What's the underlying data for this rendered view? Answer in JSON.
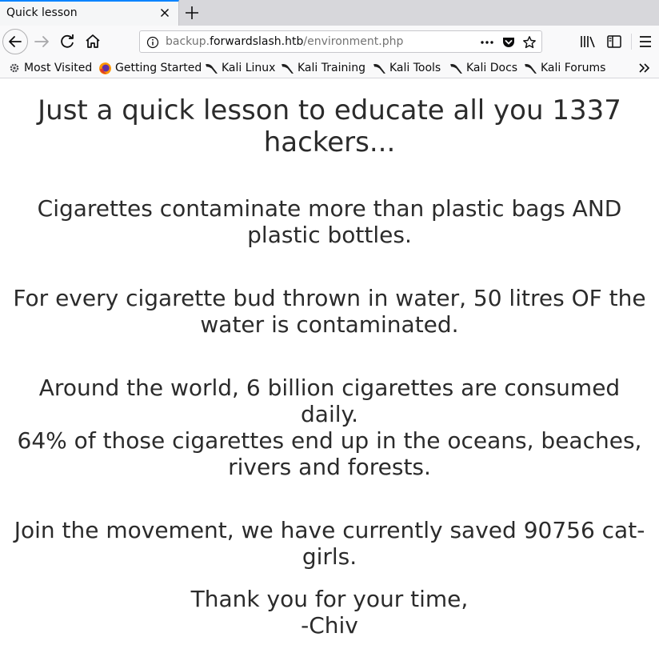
{
  "tab": {
    "title": "Quick lesson",
    "close_icon": "close-icon",
    "new_tab_icon": "plus-icon"
  },
  "nav": {
    "url_scheme_prefix": "backup.",
    "url_domain": "forwardslash.htb",
    "url_path": "/environment.php"
  },
  "bookmarks": [
    {
      "label": "Most Visited",
      "icon": "gear-icon"
    },
    {
      "label": "Getting Started",
      "icon": "firefox-icon"
    },
    {
      "label": "Kali Linux",
      "icon": "kali-dragon-icon"
    },
    {
      "label": "Kali Training",
      "icon": "kali-dragon-icon"
    },
    {
      "label": "Kali Tools",
      "icon": "kali-dragon-icon"
    },
    {
      "label": "Kali Docs",
      "icon": "kali-dragon-icon"
    },
    {
      "label": "Kali Forums",
      "icon": "kali-dragon-icon"
    }
  ],
  "content": {
    "headline": "Just a quick lesson to educate all you 1337 hackers...",
    "paragraph1": "Cigarettes contaminate more than plastic bags AND plastic bottles.",
    "paragraph2": "For every cigarette bud thrown in water, 50 litres OF the water is contaminated.",
    "paragraph3_line1": "Around the world, 6 billion cigarettes are consumed daily.",
    "paragraph3_line2": "64% of those cigarettes end up in the oceans, beaches, rivers and forests.",
    "paragraph4": "Join the movement, we have currently saved 90756 cat-girls.",
    "signoff_line1": "Thank you for your time,",
    "signoff_line2": "-Chiv"
  },
  "colors": {
    "accent": "#0a84ff",
    "text": "#2b2b2b"
  }
}
